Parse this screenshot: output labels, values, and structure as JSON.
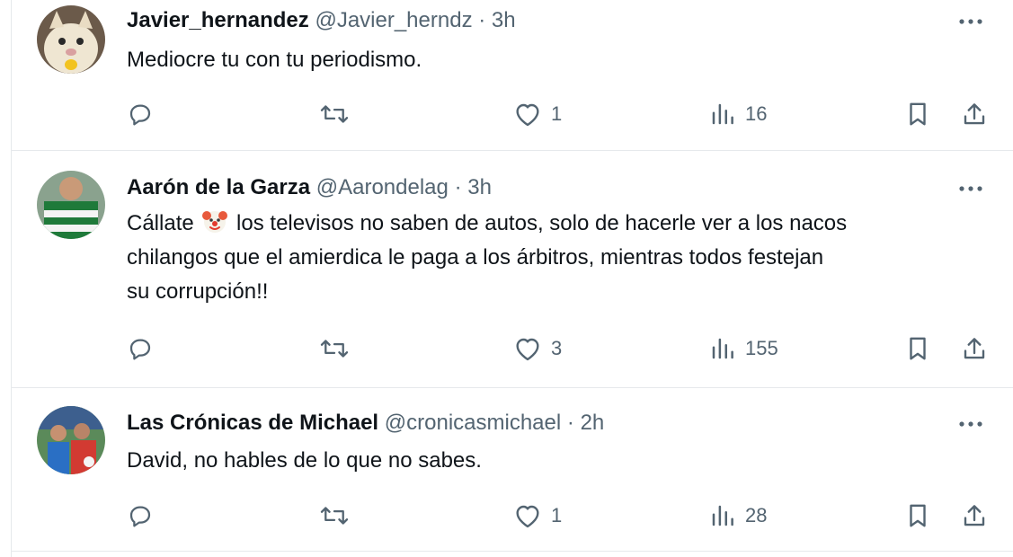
{
  "tweets": [
    {
      "name": "Javier_hernandez",
      "handle": "@Javier_herndz",
      "sep": "·",
      "time": "3h",
      "text_lines": [
        "Mediocre tu con tu periodismo."
      ],
      "replies": "",
      "retweets": "",
      "likes": "1",
      "views": "16",
      "avatar_icon": "cat-avatar"
    },
    {
      "name": "Aarón de la Garza",
      "handle": "@Aarondelag",
      "sep": "·",
      "time": "3h",
      "text_before_emoji": "Cállate",
      "emoji_icon": "clown-face-emoji",
      "text_after_emoji": " los televisos no saben de autos, solo de hacerle ver a los nacos",
      "text_lines": [
        "chilangos que el amierdica  le paga a los árbitros, mientras todos festejan",
        "su corrupción!!"
      ],
      "replies": "",
      "retweets": "",
      "likes": "3",
      "views": "155",
      "avatar_icon": "soccer-jersey-avatar"
    },
    {
      "name": "Las Crónicas de Michael",
      "handle": "@cronicasmichael",
      "sep": "·",
      "time": "2h",
      "text_lines": [
        "David, no hables de lo que no sabes."
      ],
      "replies": "",
      "retweets": "",
      "likes": "1",
      "views": "28",
      "avatar_icon": "players-avatar"
    }
  ],
  "colors": {
    "text": "#0f1419",
    "secondary": "#536471",
    "border": "#e6e9ec"
  }
}
